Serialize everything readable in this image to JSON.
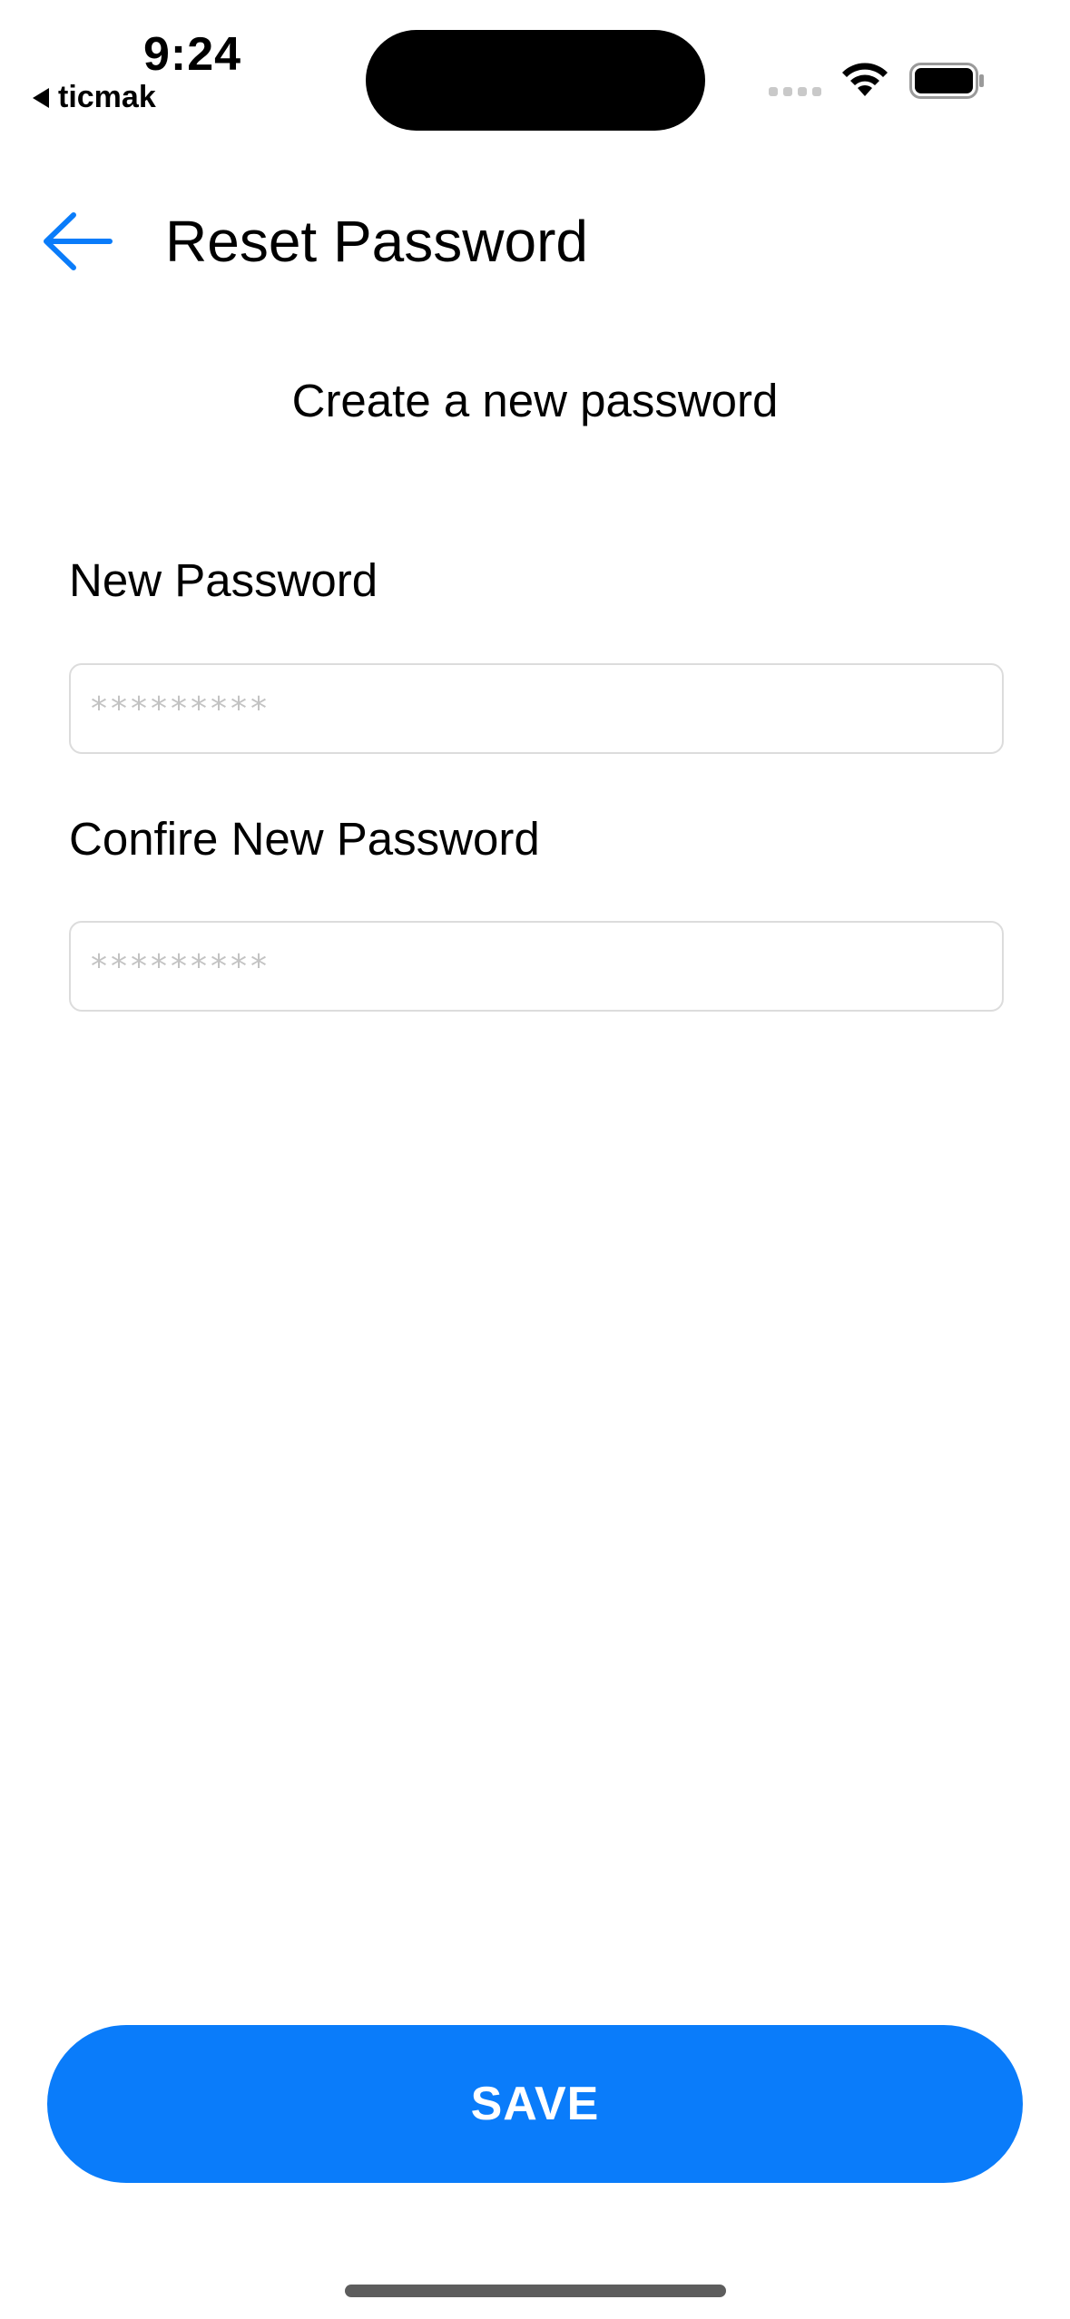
{
  "status_bar": {
    "time": "9:24",
    "back_app_label": "ticmak"
  },
  "header": {
    "title": "Reset Password",
    "back_icon": "arrow-left-icon"
  },
  "form": {
    "subtitle": "Create a new password",
    "new_password": {
      "label": "New Password",
      "placeholder": "*********",
      "value": ""
    },
    "confirm_password": {
      "label": "Confire New Password",
      "placeholder": "*********",
      "value": ""
    }
  },
  "actions": {
    "save_label": "SAVE"
  },
  "colors": {
    "accent": "#0a7cfa",
    "field_border": "#dcdcdc",
    "placeholder": "#c3c3c3"
  }
}
